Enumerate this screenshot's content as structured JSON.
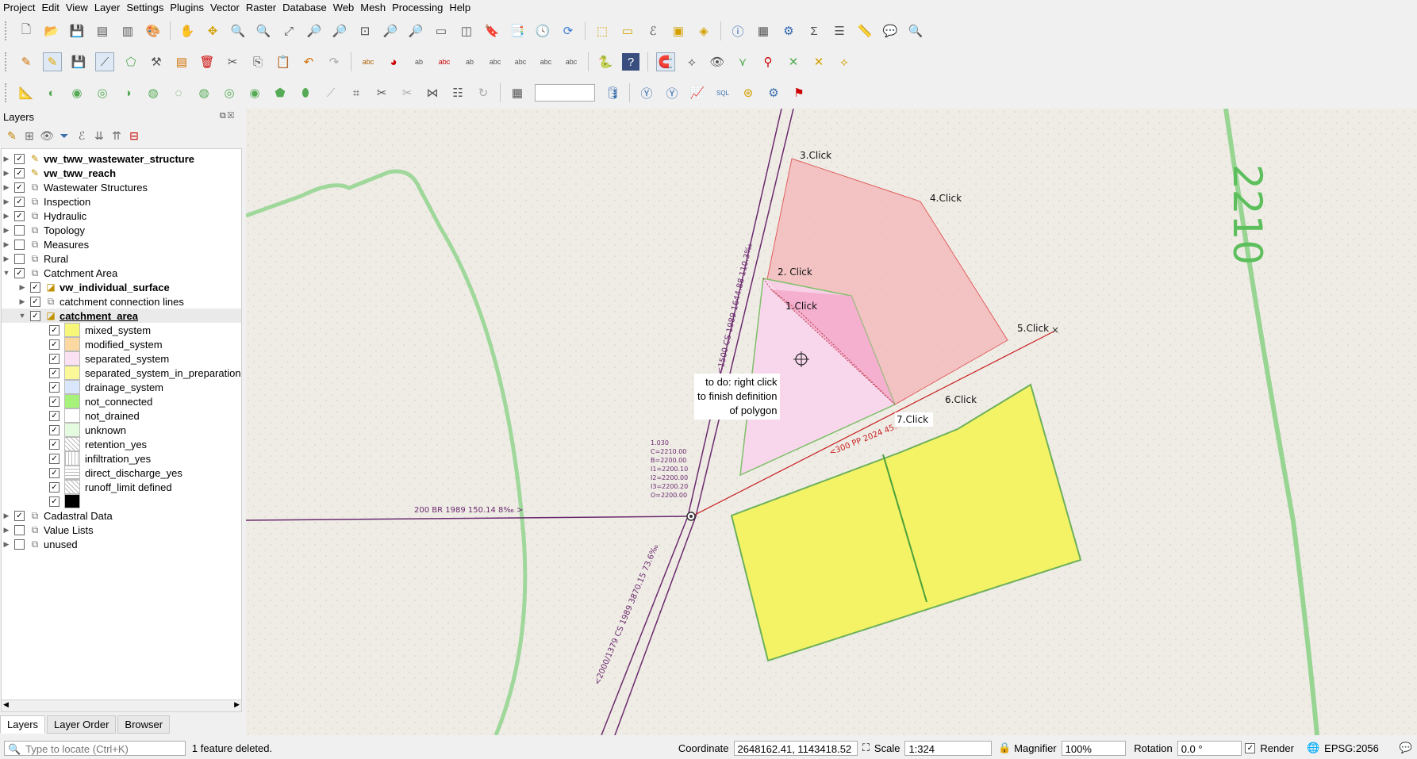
{
  "menu": [
    "Project",
    "Edit",
    "View",
    "Layer",
    "Settings",
    "Plugins",
    "Vector",
    "Raster",
    "Database",
    "Web",
    "Mesh",
    "Processing",
    "Help"
  ],
  "panel": {
    "title": "Layers",
    "tabs": [
      "Layers",
      "Layer Order",
      "Browser"
    ],
    "search_placeholder": "Type to locate (Ctrl+K)"
  },
  "layers": [
    {
      "name": "vw_tww_wastewater_structure",
      "level": 0,
      "checked": true,
      "bold": true,
      "expand": "right",
      "icon": "edit-icon"
    },
    {
      "name": "vw_tww_reach",
      "level": 0,
      "checked": true,
      "bold": true,
      "expand": "right",
      "icon": "edit-icon"
    },
    {
      "name": "Wastewater Structures",
      "level": 0,
      "checked": true,
      "bold": false,
      "expand": "right",
      "icon": "group-icon"
    },
    {
      "name": "Inspection",
      "level": 0,
      "checked": true,
      "bold": false,
      "expand": "right",
      "icon": "group-icon"
    },
    {
      "name": "Hydraulic",
      "level": 0,
      "checked": true,
      "bold": false,
      "expand": "right",
      "icon": "group-icon"
    },
    {
      "name": "Topology",
      "level": 0,
      "checked": false,
      "bold": false,
      "expand": "right",
      "icon": "group-icon"
    },
    {
      "name": "Measures",
      "level": 0,
      "checked": false,
      "bold": false,
      "expand": "right",
      "icon": "group-icon"
    },
    {
      "name": "Rural",
      "level": 0,
      "checked": false,
      "bold": false,
      "expand": "right",
      "icon": "group-icon"
    },
    {
      "name": "Catchment Area",
      "level": 0,
      "checked": true,
      "bold": false,
      "expand": "down",
      "icon": "group-icon"
    },
    {
      "name": "vw_individual_surface",
      "level": 1,
      "checked": true,
      "bold": true,
      "expand": "right",
      "icon": "polygon-edit-icon"
    },
    {
      "name": "catchment connection lines",
      "level": 1,
      "checked": true,
      "bold": false,
      "expand": "right",
      "icon": "group-icon"
    },
    {
      "name": "catchment_area",
      "level": 1,
      "checked": true,
      "bold": true,
      "underline": true,
      "expand": "down",
      "icon": "polygon-edit-icon",
      "selected": true
    }
  ],
  "legend": [
    {
      "name": "mixed_system",
      "color": "#f7f77a",
      "pattern": "solid"
    },
    {
      "name": "modified_system",
      "color": "#fbd9a0",
      "pattern": "solid"
    },
    {
      "name": "separated_system",
      "color": "#fbe2f2",
      "pattern": "solid"
    },
    {
      "name": "separated_system_in_preparation",
      "color": "#fbf89a",
      "pattern": "solid"
    },
    {
      "name": "drainage_system",
      "color": "#d9e6fb",
      "pattern": "solid"
    },
    {
      "name": "not_connected",
      "color": "#a6f27a",
      "pattern": "solid"
    },
    {
      "name": "not_drained",
      "color": "#ffffff",
      "pattern": "solid"
    },
    {
      "name": "unknown",
      "color": "#e4fbe0",
      "pattern": "solid"
    },
    {
      "name": "retention_yes",
      "color": "#ffffff",
      "pattern": "diagonal"
    },
    {
      "name": "infiltration_yes",
      "color": "#ffffff",
      "pattern": "vertical"
    },
    {
      "name": "direct_discharge_yes",
      "color": "#ffffff",
      "pattern": "horizontal"
    },
    {
      "name": "runoff_limit defined",
      "color": "#ffffff",
      "pattern": "diagonal"
    },
    {
      "name": "",
      "color": "#000000",
      "pattern": "solid"
    }
  ],
  "layers_tail": [
    {
      "name": "Cadastral Data",
      "checked": true
    },
    {
      "name": "Value Lists",
      "checked": false
    },
    {
      "name": "unused",
      "checked": false
    }
  ],
  "map": {
    "clicks": [
      "1.Click",
      "2. Click",
      "3.Click",
      "4.Click",
      "5.Click",
      "6.Click",
      "7.Click"
    ],
    "tooltip": [
      "to do: right click",
      "to finish definition",
      "of polygon"
    ],
    "pipe_labels": [
      "<1500 CS 1989 1644.88 110.3‰",
      "200 BR 1989 150.14 8‰ >",
      "<2000/1379 CS 1989 3870.15 73.6‰",
      "<300 PP 2024 45.4"
    ],
    "node_labels": [
      "1.030",
      "C=2210.00",
      "B=2200.00",
      "I1=2200.10",
      "I2=2200.00",
      "I3=2200.20",
      "O=2200.00"
    ],
    "map_text": "2210"
  },
  "status": {
    "message": "1 feature deleted.",
    "coordinate_label": "Coordinate",
    "coordinate": "2648162.41, 1143418.52",
    "scale_label": "Scale",
    "scale": "1:324",
    "magnifier_label": "Magnifier",
    "magnifier": "100%",
    "rotation_label": "Rotation",
    "rotation": "0.0 °",
    "render_label": "Render",
    "crs": "EPSG:2056"
  }
}
